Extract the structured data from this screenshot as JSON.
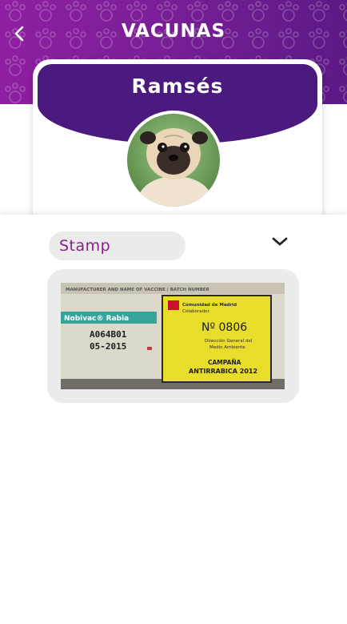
{
  "header": {
    "title": "VACUNAS",
    "back_icon": "chevron-left-icon",
    "background_colors": [
      "#8e1fa0",
      "#5c1a86"
    ]
  },
  "profile": {
    "name": "Ramsés",
    "banner_color": "#4b1a7e",
    "avatar_icon": "pug-photo"
  },
  "vaccine": {
    "selector_value": "Stamp",
    "selector_text_color": "#8a1f8c",
    "dropdown_icon": "chevron-down-icon"
  },
  "stamp_photo": {
    "left_label": {
      "brand": "Nobivac® Rabia",
      "header_text": "MANUFACTURER AND NAME OF VACCINE / BATCH NUMBER",
      "batch": "A064B01",
      "expiry": "05-2015"
    },
    "yellow_sticker": {
      "line1": "Comunidad de Madrid",
      "line2": "Colaborador",
      "number": "Nº 0806",
      "line3": "Dirección General del",
      "line4": "Medio Ambiente",
      "campaign1": "CAMPAÑA",
      "campaign2": "ANTIRRABICA 2012"
    }
  }
}
